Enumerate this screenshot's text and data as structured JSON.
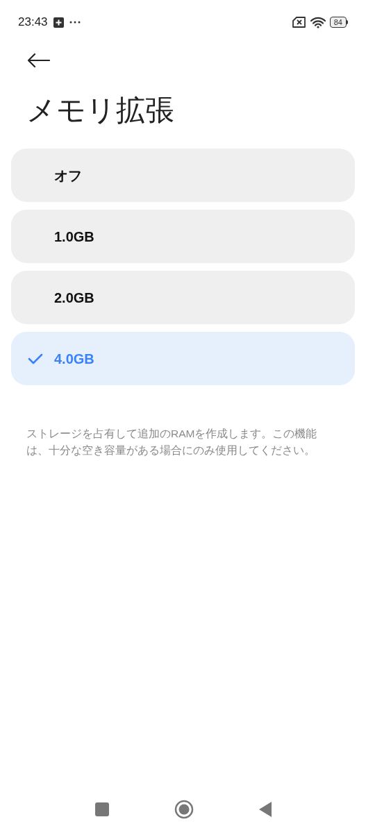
{
  "status_bar": {
    "time": "23:43",
    "battery": "84"
  },
  "title": "メモリ拡張",
  "options": [
    {
      "label": "オフ",
      "selected": false
    },
    {
      "label": "1.0GB",
      "selected": false
    },
    {
      "label": "2.0GB",
      "selected": false
    },
    {
      "label": "4.0GB",
      "selected": true
    }
  ],
  "description": "ストレージを占有して追加のRAMを作成します。この機能は、十分な空き容量がある場合にのみ使用してください。"
}
